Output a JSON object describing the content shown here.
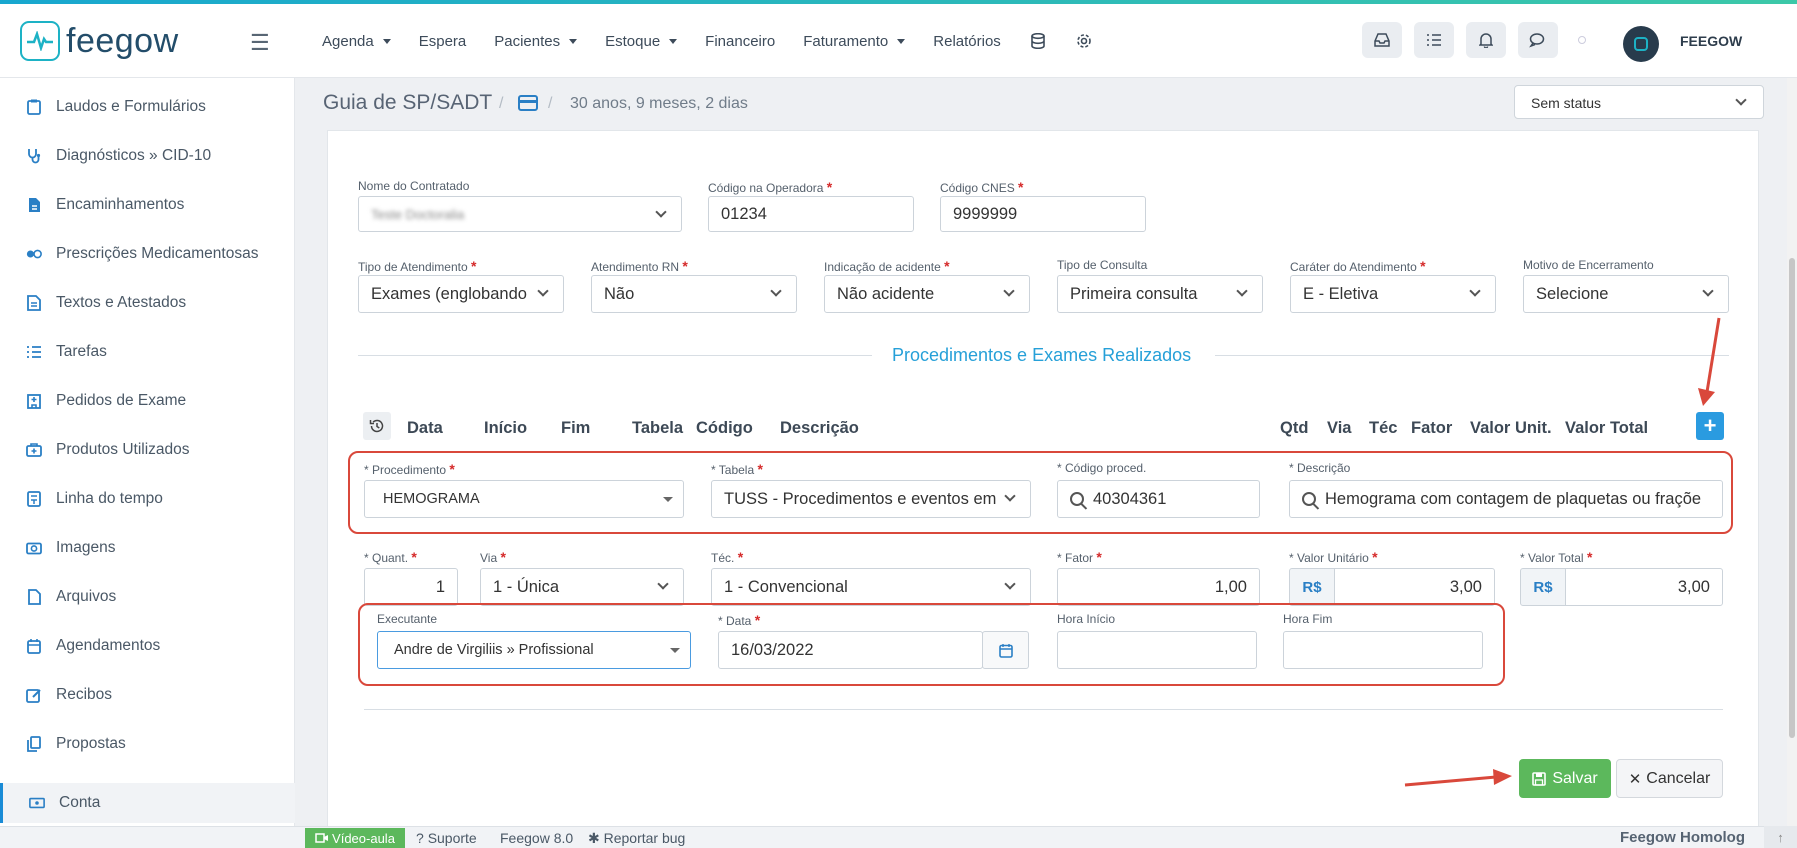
{
  "header": {
    "brand": "feegow",
    "nav": [
      {
        "label": "Agenda",
        "dropdown": true
      },
      {
        "label": "Espera",
        "dropdown": false
      },
      {
        "label": "Pacientes",
        "dropdown": true
      },
      {
        "label": "Estoque",
        "dropdown": true
      },
      {
        "label": "Financeiro",
        "dropdown": false
      },
      {
        "label": "Faturamento",
        "dropdown": true
      },
      {
        "label": "Relatórios",
        "dropdown": false
      }
    ],
    "user_name": "FEEGOW"
  },
  "sidebar": {
    "items": [
      {
        "label": "Laudos e Formulários",
        "icon": "form-icon"
      },
      {
        "label": "Diagnósticos » CID-10",
        "icon": "stethoscope-icon"
      },
      {
        "label": "Encaminhamentos",
        "icon": "file-icon"
      },
      {
        "label": "Prescrições Medicamentosas",
        "icon": "pills-icon"
      },
      {
        "label": "Textos e Atestados",
        "icon": "document-icon"
      },
      {
        "label": "Tarefas",
        "icon": "tasks-icon"
      },
      {
        "label": "Pedidos de Exame",
        "icon": "hospital-icon"
      },
      {
        "label": "Produtos Utilizados",
        "icon": "box-icon"
      },
      {
        "label": "Linha do tempo",
        "icon": "timeline-icon"
      },
      {
        "label": "Imagens",
        "icon": "camera-icon"
      },
      {
        "label": "Arquivos",
        "icon": "file-icon"
      },
      {
        "label": "Agendamentos",
        "icon": "calendar-icon"
      },
      {
        "label": "Recibos",
        "icon": "edit-icon"
      },
      {
        "label": "Propostas",
        "icon": "copy-icon"
      },
      {
        "label": "Conta",
        "icon": "money-icon",
        "active": true
      }
    ]
  },
  "breadcrumb": {
    "title": "Guia de SP/SADT",
    "age": "30 anos, 9 meses, 2 dias",
    "status": "Sem status"
  },
  "form": {
    "contratado": {
      "label": "Nome do Contratado",
      "value": "Teste Doctoralia"
    },
    "codigo_operadora": {
      "label": "Código na Operadora",
      "value": "01234"
    },
    "codigo_cnes": {
      "label": "Código CNES",
      "value": "9999999"
    },
    "tipo_atendimento": {
      "label": "Tipo de Atendimento",
      "value": "Exames (englobando"
    },
    "atendimento_rn": {
      "label": "Atendimento RN",
      "value": "Não"
    },
    "indicacao_acidente": {
      "label": "Indicação de acidente",
      "value": "Não acidente"
    },
    "tipo_consulta": {
      "label": "Tipo de Consulta",
      "value": "Primeira consulta"
    },
    "carater": {
      "label": "Caráter do Atendimento",
      "value": "E - Eletiva"
    },
    "motivo": {
      "label": "Motivo de Encerramento",
      "value": "Selecione"
    }
  },
  "procedures": {
    "section_title": "Procedimentos e Exames Realizados",
    "columns": [
      "Data",
      "Início",
      "Fim",
      "Tabela",
      "Código",
      "Descrição",
      "Qtd",
      "Via",
      "Téc",
      "Fator",
      "Valor Unit.",
      "Valor Total"
    ],
    "add_label": "+",
    "procedimento": {
      "label": "* Procedimento",
      "value": "HEMOGRAMA"
    },
    "tabela": {
      "label": "* Tabela",
      "value": "TUSS - Procedimentos e eventos em"
    },
    "codigo": {
      "label": "* Código proced.",
      "value": "40304361"
    },
    "descricao": {
      "label": "* Descrição",
      "value": "Hemograma com contagem de plaquetas ou fraçõe"
    },
    "quant": {
      "label": "* Quant.",
      "value": "1"
    },
    "via": {
      "label": "Via",
      "value": "1 - Única"
    },
    "tec": {
      "label": "Téc.",
      "value": "1 - Convencional"
    },
    "fator": {
      "label": "* Fator",
      "value": "1,00"
    },
    "valor_unitario": {
      "label": "* Valor Unitário",
      "currency": "R$",
      "value": "3,00"
    },
    "valor_total": {
      "label": "* Valor Total",
      "currency": "R$",
      "value": "3,00"
    },
    "executante": {
      "label": "Executante",
      "value": "Andre de Virgiliis » Profissional"
    },
    "data": {
      "label": "* Data",
      "value": "16/03/2022"
    },
    "hora_inicio": {
      "label": "Hora Início",
      "value": ""
    },
    "hora_fim": {
      "label": "Hora Fim",
      "value": ""
    }
  },
  "actions": {
    "save": "Salvar",
    "cancel": "Cancelar"
  },
  "footer": {
    "video": "Vídeo-aula",
    "support": "Suporte",
    "version": "Feegow 8.0",
    "bug": "Reportar bug",
    "brand": "Feegow Homolog"
  },
  "colors": {
    "accent": "#26a0d8",
    "highlight": "#d9483b",
    "save": "#5cb85c"
  }
}
